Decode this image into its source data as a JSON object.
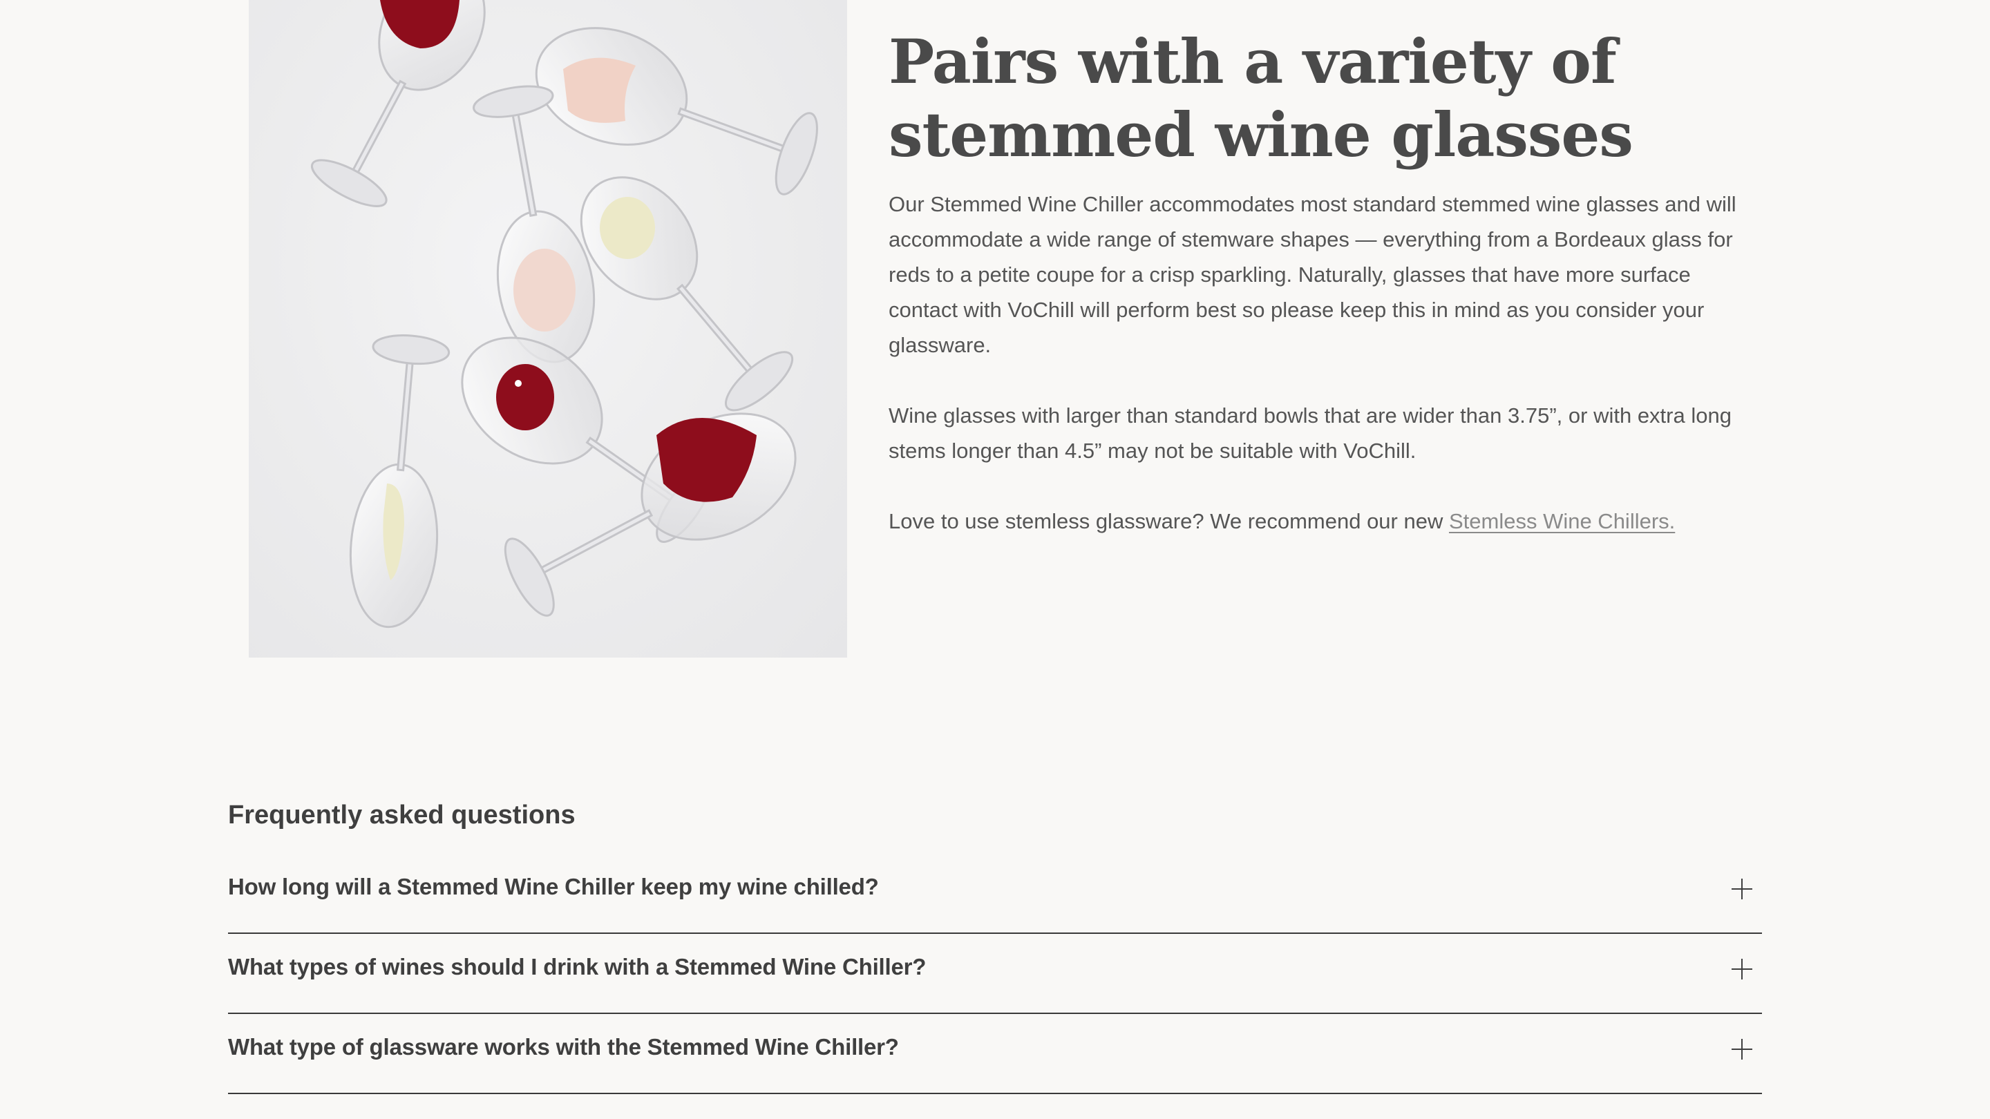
{
  "section": {
    "headline": "Pairs with a variety of stemmed wine glasses",
    "paragraphs": [
      "Our Stemmed Wine Chiller accommodates most standard stemmed wine glasses and will accommodate a wide range of stemware shapes — everything from a Bordeaux glass for reds to a petite coupe for a crisp sparkling. Naturally, glasses that have more surface contact with VoChill will perform best so please keep this in mind as you consider your glassware.",
      "Wine glasses with larger than standard bowls that are wider than 3.75”, or with extra long stems longer than 4.5” may not be suitable with VoChill."
    ],
    "cta_text": "Love to use stemless glassware? We recommend our new ",
    "cta_link": "Stemless Wine Chillers."
  },
  "image": {
    "subject": "stemmed wine glasses with red, rosé and white wine"
  },
  "faq": {
    "title": "Frequently asked questions",
    "items": [
      {
        "question": "How long will a Stemmed Wine Chiller keep my wine chilled?"
      },
      {
        "question": "What types of wines should I drink with a Stemmed Wine Chiller?"
      },
      {
        "question": "What type of glassware works with the Stemmed Wine Chiller?"
      }
    ],
    "toggle_icon": "plus-icon"
  },
  "colors": {
    "background": "#f9f8f6",
    "text": "#4a4a4a",
    "red_wine": "#8e0d1c",
    "rose_wine": "#f1d2c6",
    "white_wine": "#ece9c8"
  }
}
